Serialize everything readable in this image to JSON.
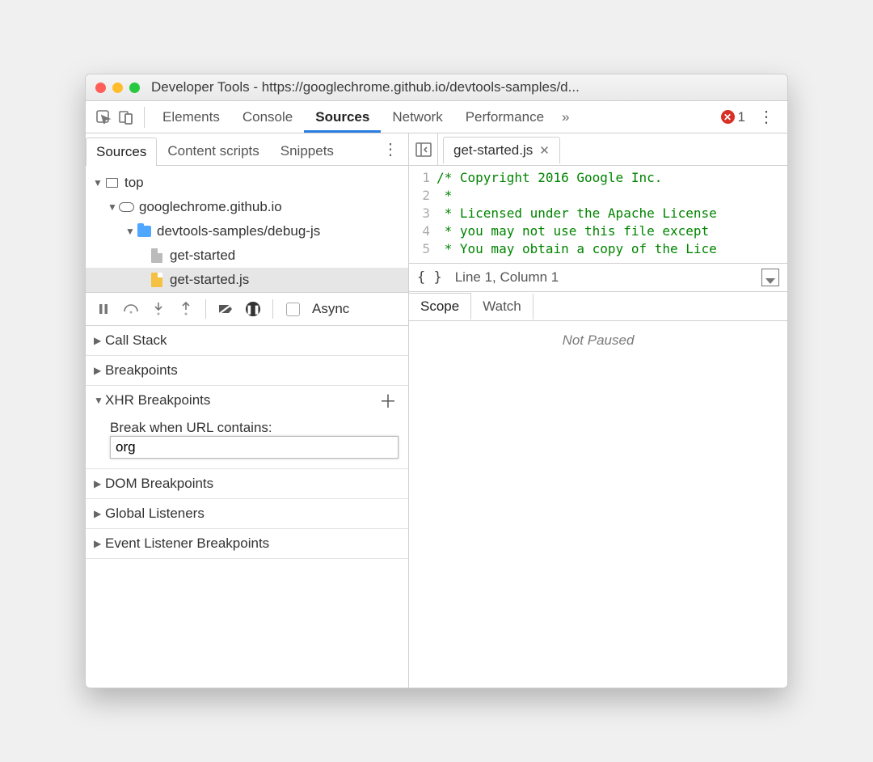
{
  "window_title": "Developer Tools - https://googlechrome.github.io/devtools-samples/d...",
  "main_tabs": {
    "elements": "Elements",
    "console": "Console",
    "sources": "Sources",
    "network": "Network",
    "performance": "Performance",
    "more_glyph": "»",
    "error_count": "1"
  },
  "nav_tabs": {
    "sources": "Sources",
    "content_scripts": "Content scripts",
    "snippets": "Snippets"
  },
  "tree": {
    "top": "top",
    "domain": "googlechrome.github.io",
    "folder": "devtools-samples/debug-js",
    "file_html": "get-started",
    "file_js": "get-started.js"
  },
  "debug_toolbar": {
    "async_label": "Async"
  },
  "sections": {
    "call_stack": "Call Stack",
    "breakpoints": "Breakpoints",
    "xhr": "XHR Breakpoints",
    "xhr_label": "Break when URL contains:",
    "xhr_value": "org",
    "dom": "DOM Breakpoints",
    "global": "Global Listeners",
    "event": "Event Listener Breakpoints"
  },
  "editor": {
    "tab_name": "get-started.js",
    "line_numbers": [
      "1",
      "2",
      "3",
      "4",
      "5"
    ],
    "lines": [
      "/* Copyright 2016 Google Inc.",
      " *",
      " * Licensed under the Apache License",
      " * you may not use this file except ",
      " * You may obtain a copy of the Lice"
    ],
    "footer_brace": "{ }",
    "footer_pos": "Line 1, Column 1"
  },
  "right_tabs": {
    "scope": "Scope",
    "watch": "Watch",
    "not_paused": "Not Paused"
  }
}
